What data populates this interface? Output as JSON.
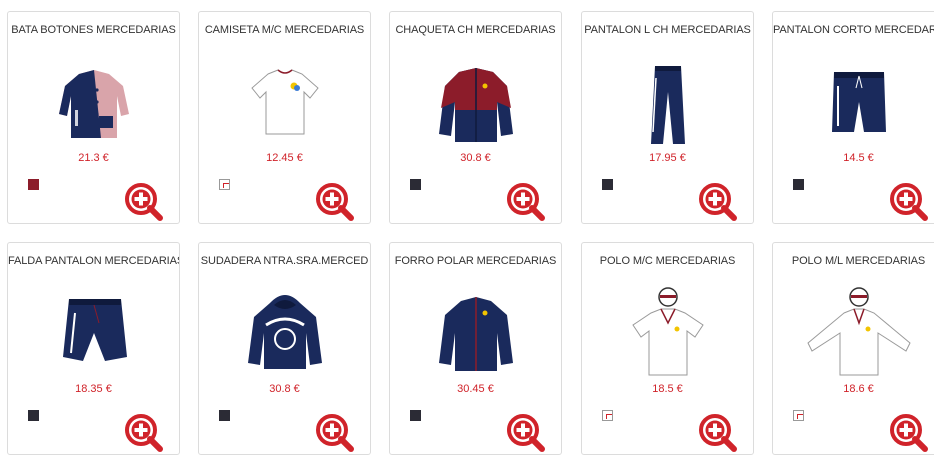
{
  "colors": {
    "price": "#d0232a",
    "navy": "#1a2a5c",
    "maroon": "#8c1c2a",
    "dark_swatch": "#2b2b35",
    "zoom": "#d0232a"
  },
  "products": [
    {
      "title": "BATA BOTONES MERCEDARIAS",
      "price": "21.3 €",
      "swatch": "maroon",
      "image": "bata-illustration"
    },
    {
      "title": "CAMISETA M/C MERCEDARIAS",
      "price": "12.45 €",
      "swatch": "white",
      "image": "camiseta-illustration"
    },
    {
      "title": "CHAQUETA CH MERCEDARIAS",
      "price": "30.8 €",
      "swatch": "navy",
      "image": "chaqueta-illustration"
    },
    {
      "title": "PANTALON L CH MERCEDARIAS",
      "price": "17.95 €",
      "swatch": "navy",
      "image": "pantalon-largo-illustration"
    },
    {
      "title": "PANTALON CORTO MERCEDARIAS",
      "price": "14.5 €",
      "swatch": "navy",
      "image": "pantalon-corto-illustration"
    },
    {
      "title": "FALDA PANTALON MERCEDARIAS",
      "price": "18.35 €",
      "swatch": "navy",
      "image": "falda-illustration"
    },
    {
      "title": "SUDADERA NTRA.SRA.MERCED",
      "price": "30.8 €",
      "swatch": "navy",
      "image": "sudadera-illustration"
    },
    {
      "title": "FORRO POLAR MERCEDARIAS",
      "price": "30.45 €",
      "swatch": "navy",
      "image": "forro-polar-illustration"
    },
    {
      "title": "POLO M/C MERCEDARIAS",
      "price": "18.5 €",
      "swatch": "white",
      "image": "polo-mc-illustration"
    },
    {
      "title": "POLO M/L MERCEDARIAS",
      "price": "18.6 €",
      "swatch": "white",
      "image": "polo-ml-illustration"
    }
  ],
  "icons": {
    "zoom": "zoom-plus-icon",
    "swatch": "color-swatch-icon"
  },
  "brand_text": {
    "print": "MERCEDARIAS"
  }
}
